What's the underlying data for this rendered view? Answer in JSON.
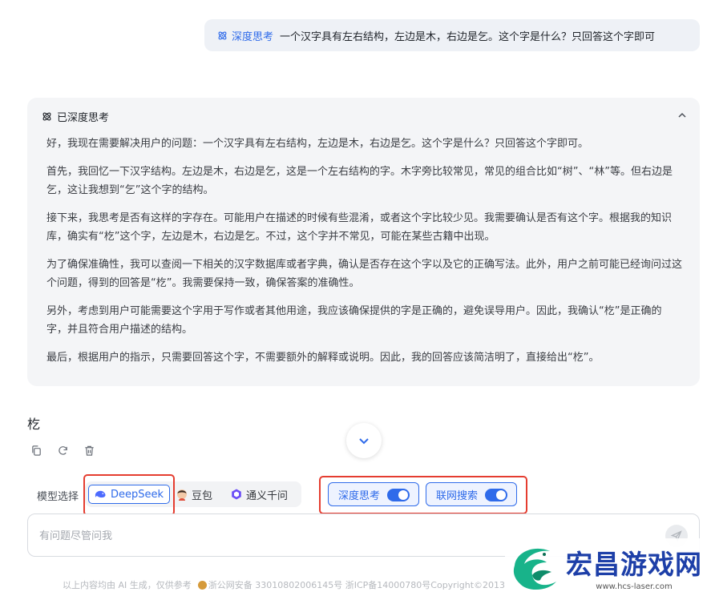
{
  "user_message": {
    "tag": "深度思考",
    "text": "一个汉字具有左右结构，左边是木，右边是乞。这个字是什么？只回答这个字即可"
  },
  "thinking": {
    "header": "已深度思考",
    "paragraphs": [
      "好，我现在需要解决用户的问题：一个汉字具有左右结构，左边是木，右边是乞。这个字是什么？只回答这个字即可。",
      "首先，我回忆一下汉字结构。左边是木，右边是乞，这是一个左右结构的字。木字旁比较常见，常见的组合比如“树”、“林”等。但右边是乞，这让我想到“乞”这个字的结构。",
      "接下来，我思考是否有这样的字存在。可能用户在描述的时候有些混淆，或者这个字比较少见。我需要确认是否有这个字。根据我的知识库，确实有“杚”这个字，左边是木，右边是乞。不过，这个字并不常见，可能在某些古籍中出现。",
      "为了确保准确性，我可以查阅一下相关的汉字数据库或者字典，确认是否存在这个字以及它的正确写法。此外，用户之前可能已经询问过这个问题，得到的回答是“杚”。我需要保持一致，确保答案的准确性。",
      "另外，考虑到用户可能需要这个字用于写作或者其他用途，我应该确保提供的字是正确的，避免误导用户。因此，我确认“杚”是正确的字，并且符合用户描述的结构。",
      "最后，根据用户的指示，只需要回答这个字，不需要额外的解释或说明。因此，我的回答应该简洁明了，直接给出“杚”。"
    ]
  },
  "answer": "杚",
  "actions": {
    "icons": [
      "copy-icon",
      "refresh-icon",
      "trash-icon"
    ]
  },
  "model_select": {
    "label": "模型选择",
    "options": [
      {
        "label": "DeepSeek",
        "icon": "deepseek-whale-icon",
        "active": true
      },
      {
        "label": "豆包",
        "icon": "doubao-avatar-icon",
        "active": false
      },
      {
        "label": "通义千问",
        "icon": "tongyi-icon",
        "active": false
      }
    ]
  },
  "toggles": [
    {
      "label": "深度思考",
      "on": true
    },
    {
      "label": "联网搜索",
      "on": true
    }
  ],
  "input": {
    "placeholder": "有问题尽管问我",
    "value": ""
  },
  "footer": {
    "disclaimer": "以上内容均由 AI 生成，仅供参考",
    "record": "浙公网安备 33010802006145号 浙ICP备14000780号Copyright©2013"
  },
  "watermark": {
    "title": "宏昌游戏网",
    "url": "www.hcs-laser.com"
  },
  "colors": {
    "accent": "#2f6bea",
    "highlight_box": "#e53d30",
    "card_bg": "#f4f5f7"
  }
}
